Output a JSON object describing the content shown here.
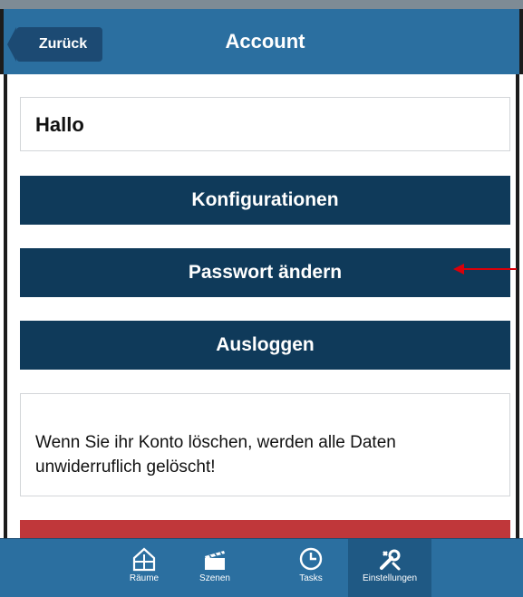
{
  "header": {
    "back_label": "Zurück",
    "title": "Account"
  },
  "greeting": "Hallo",
  "buttons": {
    "configurations": "Konfigurationen",
    "change_password": "Passwort ändern",
    "logout": "Ausloggen"
  },
  "info_text": "Wenn Sie ihr Konto löschen, werden alle Daten unwiderruflich gelöscht!",
  "tabs": [
    {
      "label": "Räume",
      "icon": "house-icon"
    },
    {
      "label": "Szenen",
      "icon": "clapperboard-icon"
    },
    {
      "label": "Tasks",
      "icon": "clock-icon"
    },
    {
      "label": "Einstellungen",
      "icon": "settings-icon",
      "active": true
    }
  ],
  "colors": {
    "header": "#2b6fa0",
    "button": "#0f3a5a",
    "danger": "#c0373a",
    "annotation_arrow": "#d9000a"
  }
}
